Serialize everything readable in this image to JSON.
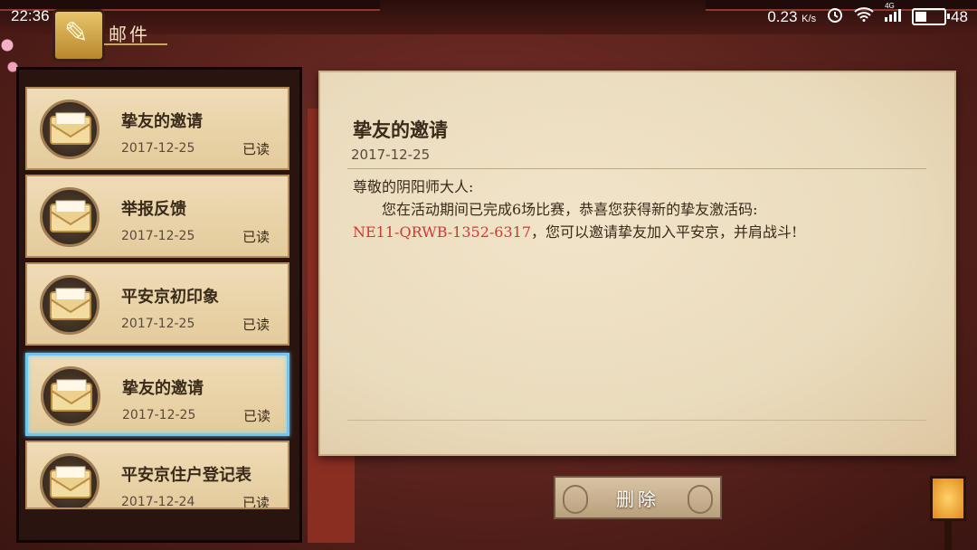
{
  "status_bar": {
    "time": "22:36",
    "net_speed": "0.23",
    "net_unit": "K/s",
    "network_type": "4G",
    "battery": "48",
    "battery_level": 0.48
  },
  "header": {
    "title": "邮件",
    "icon": "quill-icon"
  },
  "mail_list": [
    {
      "title": "挚友的邀请",
      "date": "2017-12-25",
      "status": "已读",
      "selected": false
    },
    {
      "title": "举报反馈",
      "date": "2017-12-25",
      "status": "已读",
      "selected": false
    },
    {
      "title": "平安京初印象",
      "date": "2017-12-25",
      "status": "已读",
      "selected": false
    },
    {
      "title": "挚友的邀请",
      "date": "2017-12-25",
      "status": "已读",
      "selected": true
    },
    {
      "title": "平安京住户登记表",
      "date": "2017-12-24",
      "status": "已读",
      "selected": false
    }
  ],
  "detail": {
    "title": "挚友的邀请",
    "date": "2017-12-25",
    "greeting": "尊敬的阴阳师大人:",
    "body_line1": "您在活动期间已完成6场比赛，恭喜您获得新的挚友激活码:",
    "code": "NE11-QRWB-1352-6317",
    "body_line2": "，您可以邀请挚友加入平安京，并肩战斗!"
  },
  "actions": {
    "delete_label": "删除"
  },
  "colors": {
    "selected_border": "#6fc6f2",
    "code_text": "#cc3b32",
    "paper": "#f2e4c9",
    "background": "#5a221c"
  }
}
